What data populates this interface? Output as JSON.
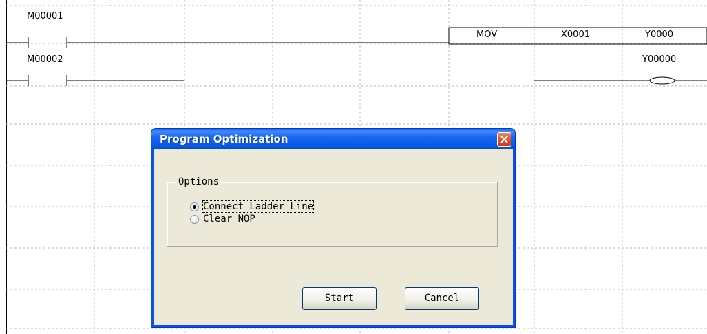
{
  "ladder": {
    "rung1_contact": "M00001",
    "rung2_contact": "M00002",
    "instruction": [
      "MOV",
      "X0001",
      "Y0000"
    ],
    "coil_label": "Y00000"
  },
  "dialog": {
    "title": "Program Optimization",
    "group_label": "Options",
    "options": [
      {
        "label": "Connect Ladder Line",
        "selected": true
      },
      {
        "label": "Clear NOP",
        "selected": false
      }
    ],
    "start_label": "Start",
    "cancel_label": "Cancel"
  },
  "colors": {
    "title_bar": "#0a53e3",
    "close_button": "#e14a22",
    "dialog_body": "#ece9d8",
    "grid_line": "#b0b0b0"
  }
}
